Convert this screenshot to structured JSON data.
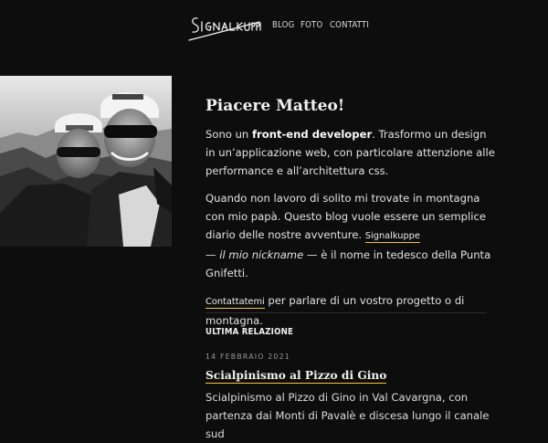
{
  "header": {
    "logo_text": "Signalkuppe",
    "nav": [
      {
        "label": "BLOG"
      },
      {
        "label": "FOTO"
      },
      {
        "label": "CONTATTI"
      }
    ]
  },
  "intro": {
    "greeting": "Piacere Matteo!",
    "p1_before": "Sono un ",
    "p1_bold": "front-end developer",
    "p1_after": ". Trasformo un design in un’applicazione web, con particolare attenzione alle performance e all’architettura css.",
    "p2_before": "Quando non lavoro di solito mi trovate in montagna con mio papà. Questo blog vuole essere un semplice diario delle nostre avventure. ",
    "p2_link": "Signalkuppe",
    "p2_after_1": "— ",
    "p2_italic": "il mio nickname",
    "p2_after_2": " — è il nome in tedesco della Punta Gnifetti.",
    "p3_link": "Contattatemi",
    "p3_after": " per parlare di un vostro progetto o di montagna."
  },
  "latest": {
    "section_title": "ULTIMA RELAZIONE",
    "date": "14 FEBBRAIO 2021",
    "title": "Scialpinismo al Pizzo di Gino",
    "excerpt": "Scialpinismo al Pizzo di Gino in Val Cavargna, con partenza dai Monti di Pavalè e discesa lungo il canale sud"
  },
  "colors": {
    "background": "#0d0d0e",
    "accent_underline": "#f4c542"
  }
}
